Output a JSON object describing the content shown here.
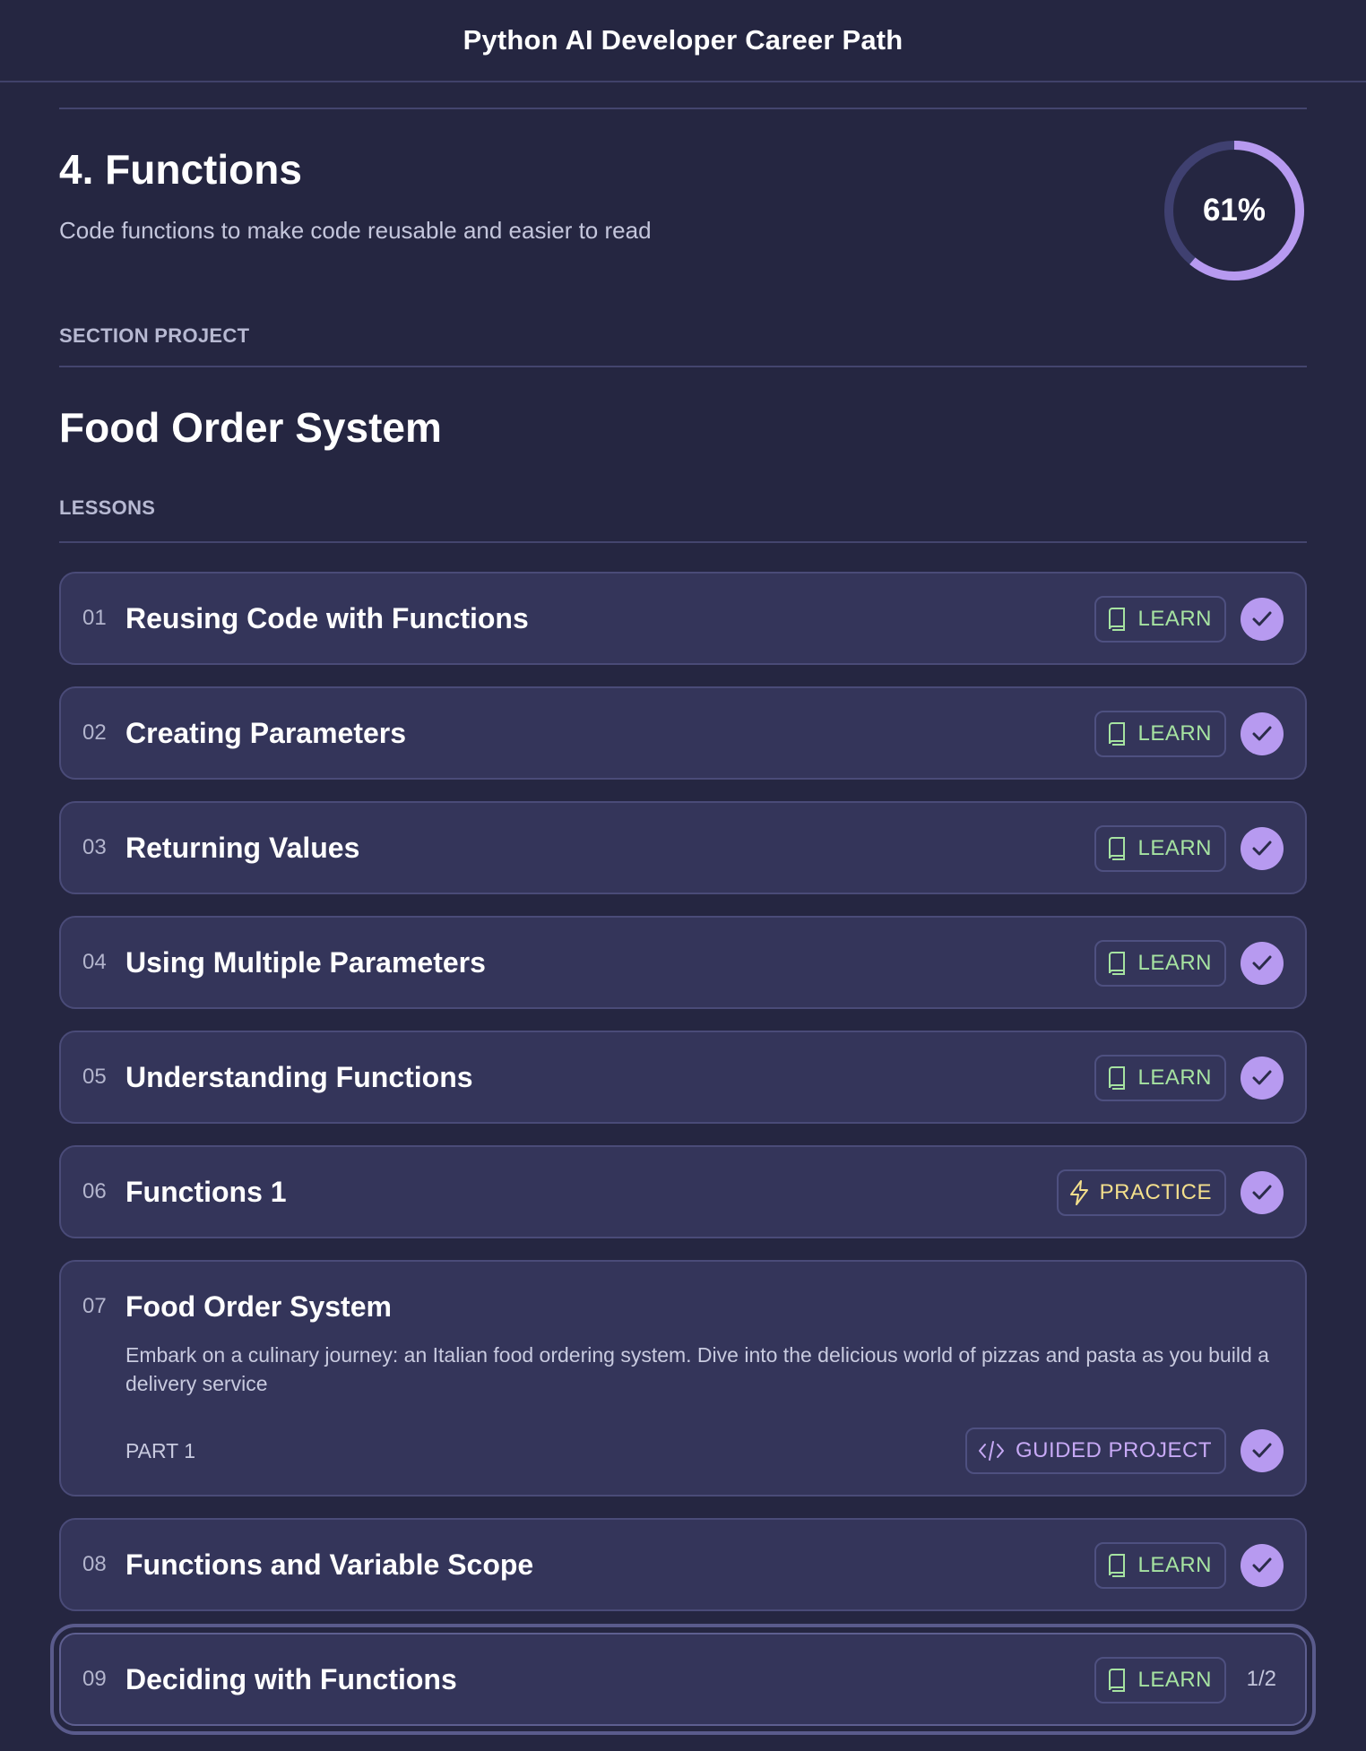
{
  "topbar": {
    "title": "Python AI Developer Career Path"
  },
  "section": {
    "title": "4. Functions",
    "subtitle": "Code functions to make code reusable and easier to read",
    "progress_percent": 61,
    "progress_label": "61%",
    "overline": "SECTION PROJECT"
  },
  "project": {
    "title": "Food Order System"
  },
  "lessons_label": "LESSONS",
  "colors": {
    "background": "#252641",
    "card": "#34355a",
    "accent_purple": "#b79af0",
    "learn_green": "#a6e3a1",
    "practice_yellow": "#f3df8c",
    "guided_purple": "#c7a9f5"
  },
  "lessons": [
    {
      "num": "01",
      "title": "Reusing Code with Functions",
      "badge": "LEARN",
      "badge_icon": "book-icon",
      "completed": true
    },
    {
      "num": "02",
      "title": "Creating Parameters",
      "badge": "LEARN",
      "badge_icon": "book-icon",
      "completed": true
    },
    {
      "num": "03",
      "title": "Returning Values",
      "badge": "LEARN",
      "badge_icon": "book-icon",
      "completed": true
    },
    {
      "num": "04",
      "title": "Using Multiple Parameters",
      "badge": "LEARN",
      "badge_icon": "book-icon",
      "completed": true
    },
    {
      "num": "05",
      "title": "Understanding Functions",
      "badge": "LEARN",
      "badge_icon": "book-icon",
      "completed": true
    },
    {
      "num": "06",
      "title": "Functions 1",
      "badge": "PRACTICE",
      "badge_icon": "lightning-icon",
      "completed": true
    },
    {
      "num": "07",
      "title": "Food Order System",
      "description": "Embark on a culinary journey: an Italian food ordering system. Dive into the delicious world of pizzas and pasta as you build a delivery service",
      "part": "PART 1",
      "badge": "GUIDED PROJECT",
      "badge_icon": "code-icon",
      "completed": true
    },
    {
      "num": "08",
      "title": "Functions and Variable Scope",
      "badge": "LEARN",
      "badge_icon": "book-icon",
      "completed": true
    },
    {
      "num": "09",
      "title": "Deciding with Functions",
      "badge": "LEARN",
      "badge_icon": "book-icon",
      "completed": false,
      "progress": "1/2"
    }
  ]
}
